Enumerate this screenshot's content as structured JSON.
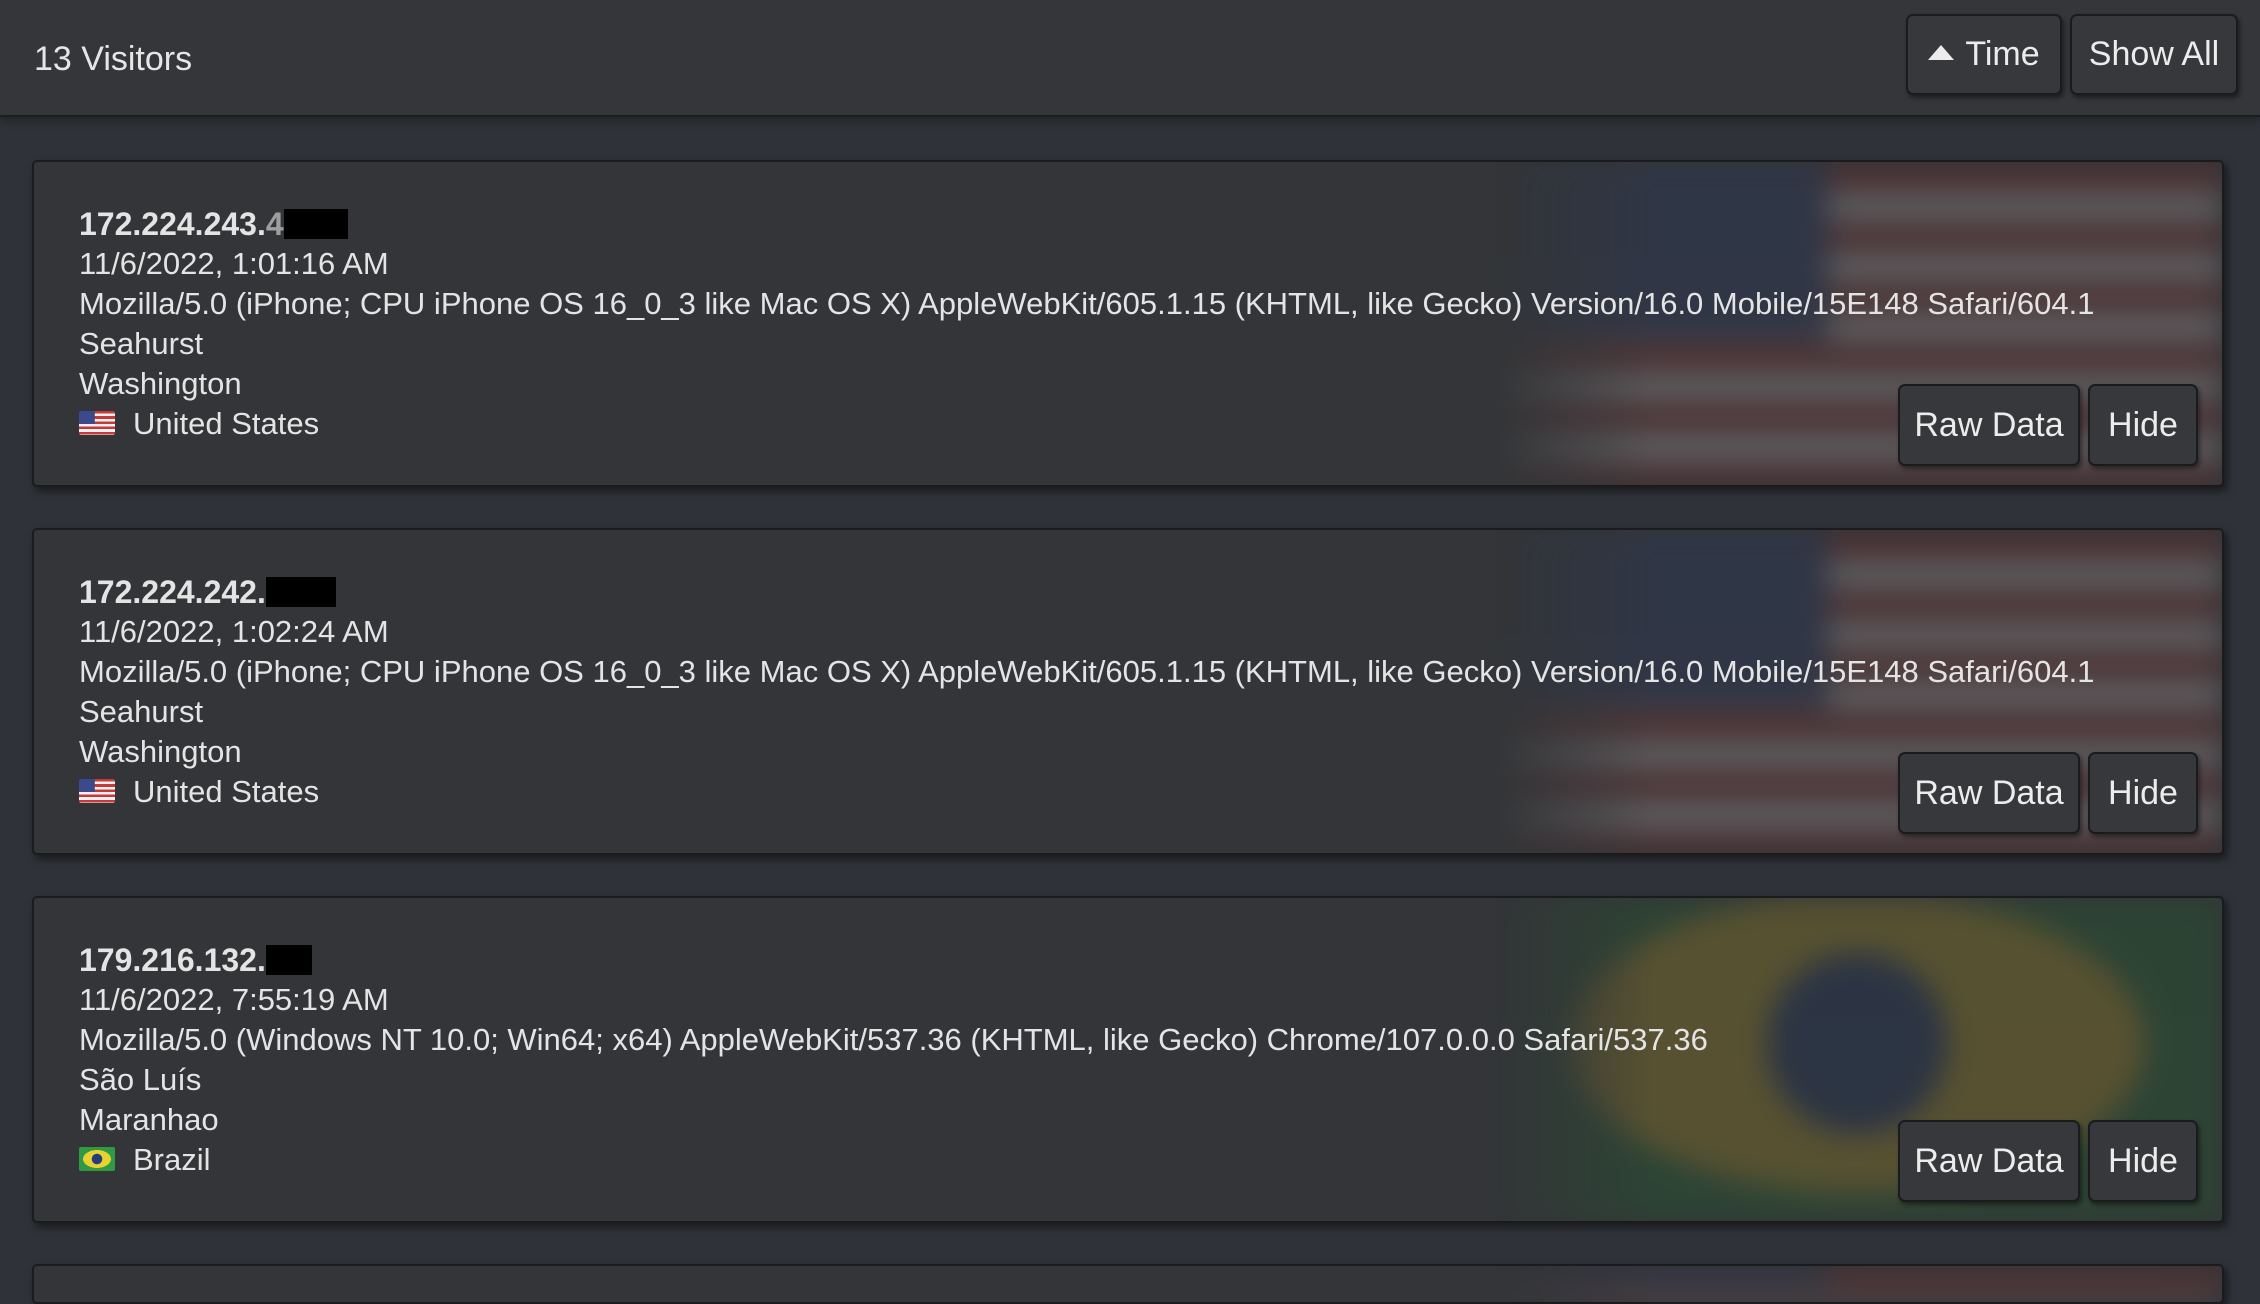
{
  "header": {
    "visitor_count": "13 Visitors",
    "sort_button_label": "Time",
    "sort_icon": "caret-up-icon",
    "show_all_label": "Show All"
  },
  "visitors": [
    {
      "ip": "172.224.243.",
      "ip_trailing_glyph": "4",
      "time": "11/6/2022, 1:01:16 AM",
      "user_agent": "Mozilla/5.0 (iPhone; CPU iPhone OS 16_0_3 like Mac OS X) AppleWebKit/605.1.15 (KHTML, like Gecko) Version/16.0 Mobile/15E148 Safari/604.1",
      "city": "Seahurst",
      "region": "Washington",
      "country": "United States",
      "flag": "us-flag-icon",
      "raw_data_label": "Raw Data",
      "hide_label": "Hide"
    },
    {
      "ip": "172.224.242.",
      "time": "11/6/2022, 1:02:24 AM",
      "user_agent": "Mozilla/5.0 (iPhone; CPU iPhone OS 16_0_3 like Mac OS X) AppleWebKit/605.1.15 (KHTML, like Gecko) Version/16.0 Mobile/15E148 Safari/604.1",
      "city": "Seahurst",
      "region": "Washington",
      "country": "United States",
      "flag": "us-flag-icon",
      "raw_data_label": "Raw Data",
      "hide_label": "Hide"
    },
    {
      "ip": "179.216.132.",
      "time": "11/6/2022, 7:55:19 AM",
      "user_agent": "Mozilla/5.0 (Windows NT 10.0; Win64; x64) AppleWebKit/537.36 (KHTML, like Gecko) Chrome/107.0.0.0 Safari/537.36",
      "city": "São Luís",
      "region": "Maranhao",
      "country": "Brazil",
      "flag": "br-flag-icon",
      "raw_data_label": "Raw Data",
      "hide_label": "Hide"
    }
  ],
  "colors": {
    "background": "#2f3239",
    "card": "#333538",
    "button": "#36383b",
    "border": "#1a1b1d",
    "text": "#e4e4e4"
  }
}
